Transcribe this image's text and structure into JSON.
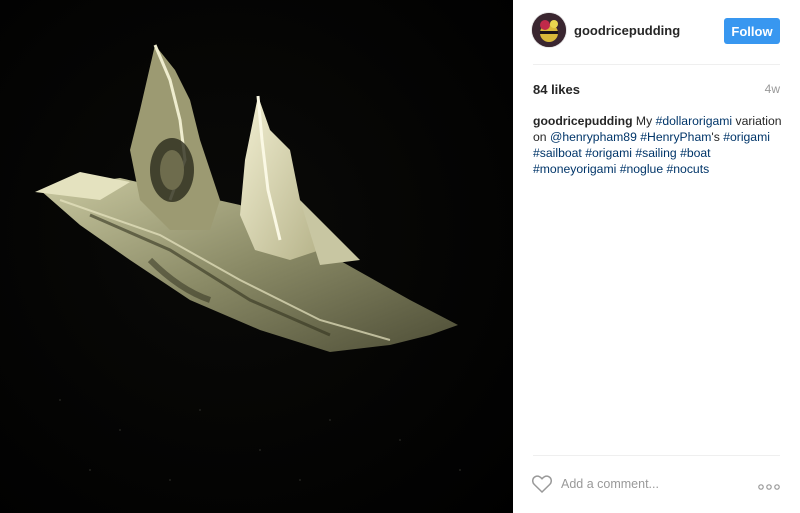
{
  "post": {
    "image_alt": "dollar origami sailboat photo"
  },
  "header": {
    "username": "goodricepudding",
    "follow_label": "Follow"
  },
  "stats": {
    "likes": "84 likes",
    "time": "4w"
  },
  "caption": {
    "username": "goodricepudding",
    "t1": " My ",
    "tag1": "#dollarorigami",
    "t2": " variation on ",
    "mention": "@henrypham89",
    "sp1": " ",
    "tag2": "#HenryPham",
    "t3": "'s ",
    "tag3": "#origami",
    "sp2": " ",
    "tag4": "#sailboat",
    "sp3": " ",
    "tag5": "#origami",
    "sp4": " ",
    "tag6": "#sailing",
    "sp5": " ",
    "tag7": "#boat",
    "sp6": " ",
    "tag8": "#moneyorigami",
    "sp7": " ",
    "tag9": "#noglue",
    "sp8": " ",
    "tag10": "#nocuts"
  },
  "comment": {
    "placeholder": "Add a comment..."
  },
  "icons": {
    "like": "heart-outline-icon",
    "more": "more-options-icon"
  },
  "colors": {
    "follow_button": "#3897f0",
    "link": "#003569",
    "muted": "#999999"
  }
}
